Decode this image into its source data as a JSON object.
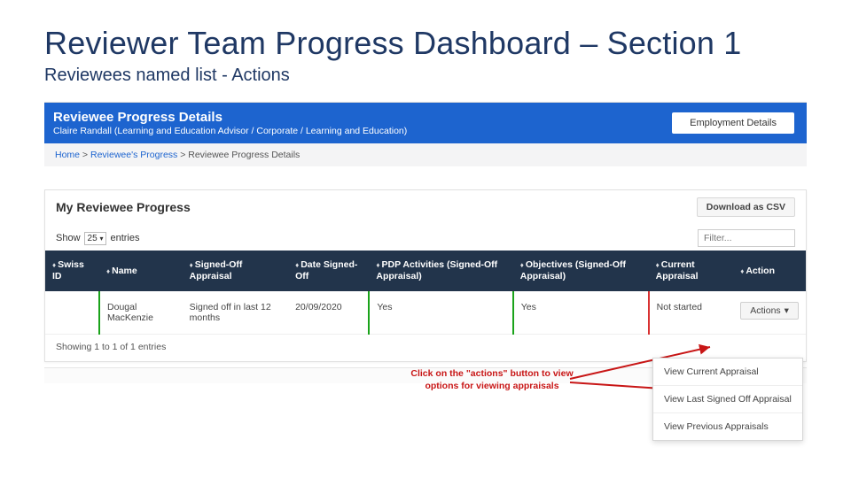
{
  "slide": {
    "title": "Reviewer Team Progress Dashboard – Section 1",
    "subtitle": "Reviewees named list - Actions"
  },
  "header": {
    "title": "Reviewee Progress Details",
    "subtitle": "Claire Randall (Learning and Education Advisor / Corporate / Learning and Education)",
    "button": "Employment Details"
  },
  "breadcrumb": {
    "home": "Home",
    "mid": "Reviewee's Progress",
    "current": "Reviewee Progress Details",
    "sep": " > "
  },
  "panel": {
    "title": "My Reviewee Progress",
    "csv": "Download as CSV"
  },
  "controls": {
    "show": "Show",
    "entries": "entries",
    "page_size": "25",
    "filter_placeholder": "Filter..."
  },
  "columns": {
    "swiss_id": "Swiss ID",
    "name": "Name",
    "signed_off": "Signed-Off Appraisal",
    "date_signed": "Date Signed-Off",
    "pdp": "PDP Activities (Signed-Off Appraisal)",
    "objectives": "Objectives (Signed-Off Appraisal)",
    "current": "Current Appraisal",
    "action": "Action"
  },
  "rows": [
    {
      "swiss_id": "",
      "name": "Dougal MacKenzie",
      "signed_off": "Signed off in last 12 months",
      "date_signed": "20/09/2020",
      "pdp": "Yes",
      "objectives": "Yes",
      "current": "Not started",
      "action_label": "Actions",
      "caret": "▾"
    }
  ],
  "showing": "Showing 1 to 1 of 1 entries",
  "annotation": "Click on the \"actions\" button to view options for viewing appraisals",
  "actions_menu": {
    "item1": "View Current Appraisal",
    "item2": "View Last Signed Off Appraisal",
    "item3": "View Previous Appraisals"
  }
}
